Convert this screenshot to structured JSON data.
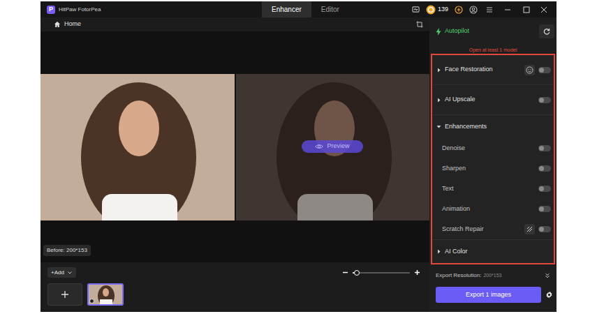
{
  "app": {
    "logo": "P",
    "title": "HitPaw FotorPea"
  },
  "tabs": [
    {
      "label": "Enhancer",
      "selected": true
    },
    {
      "label": "Editor",
      "selected": false
    }
  ],
  "coins": "139",
  "home": {
    "label": "Home"
  },
  "preview": {
    "before_label": "Before: 200*153",
    "preview_button": "Preview"
  },
  "toolbar": {
    "add_label": "+Add",
    "zoom_level": 0.07
  },
  "thumbnails": [
    {
      "selected": true
    }
  ],
  "panel": {
    "autopilot": "Autopilot",
    "warning": "Open at least 1 model",
    "models": [
      {
        "kind": "toggle",
        "label": "Face Restoration",
        "expanded": false,
        "on": false,
        "extra_button": true
      },
      {
        "kind": "toggle",
        "label": "AI Upscale",
        "expanded": false,
        "on": false,
        "extra_button": false
      },
      {
        "kind": "group",
        "label": "Enhancements",
        "expanded": true,
        "options": [
          {
            "label": "Denoise",
            "on": false,
            "extra_button": false
          },
          {
            "label": "Sharpen",
            "on": false,
            "extra_button": false
          },
          {
            "label": "Text",
            "on": false,
            "extra_button": false
          },
          {
            "label": "Animation",
            "on": false,
            "extra_button": false
          },
          {
            "label": "Scratch Repair",
            "on": false,
            "extra_button": true
          }
        ]
      },
      {
        "kind": "group",
        "label": "AI Color",
        "expanded": false,
        "options": []
      }
    ]
  },
  "export": {
    "label": "Export Resolution:",
    "value": "200*153",
    "button": "Export 1 images"
  }
}
